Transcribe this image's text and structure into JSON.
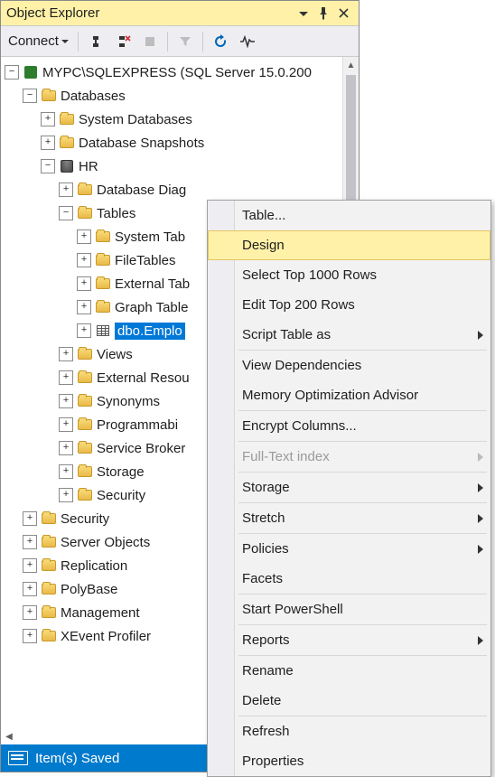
{
  "titlebar": {
    "title": "Object Explorer"
  },
  "toolbar": {
    "connect": "Connect"
  },
  "tree": {
    "server": "MYPC\\SQLEXPRESS (SQL Server 15.0.200",
    "databases": "Databases",
    "sysdb": "System Databases",
    "dbsnap": "Database Snapshots",
    "hr": "HR",
    "dbdiag": "Database Diag",
    "tables": "Tables",
    "systables": "System Tab",
    "filetables": "FileTables",
    "exttables": "External Tab",
    "graphtables": "Graph Table",
    "selected": "dbo.Emplo",
    "views": "Views",
    "extres": "External Resou",
    "synonyms": "Synonyms",
    "prog": "Programmabi",
    "svcbroker": "Service Broker",
    "storage": "Storage",
    "security_inner": "Security",
    "security": "Security",
    "serverobj": "Server Objects",
    "replication": "Replication",
    "polybase": "PolyBase",
    "management": "Management",
    "xevent": "XEvent Profiler"
  },
  "menu": {
    "new_table": "Table...",
    "design": "Design",
    "select_top": "Select Top 1000 Rows",
    "edit_top": "Edit Top 200 Rows",
    "script_as": "Script Table as",
    "view_deps": "View Dependencies",
    "mem_opt": "Memory Optimization Advisor",
    "encrypt": "Encrypt Columns...",
    "fulltext": "Full-Text index",
    "storage": "Storage",
    "stretch": "Stretch",
    "policies": "Policies",
    "facets": "Facets",
    "powershell": "Start PowerShell",
    "reports": "Reports",
    "rename": "Rename",
    "delete": "Delete",
    "refresh": "Refresh",
    "properties": "Properties"
  },
  "status": {
    "text": "Item(s) Saved"
  }
}
